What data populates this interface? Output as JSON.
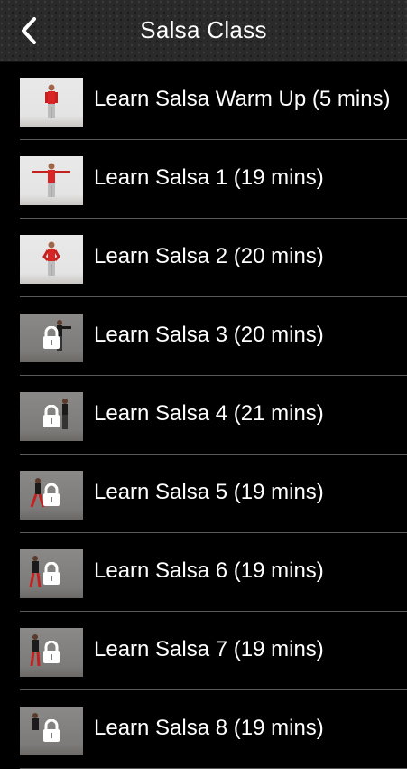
{
  "header": {
    "title": "Salsa Class",
    "back_label": "<"
  },
  "lessons": [
    {
      "title": "Learn Salsa Warm Up (5 mins)",
      "locked": false
    },
    {
      "title": "Learn Salsa 1 (19 mins)",
      "locked": false
    },
    {
      "title": "Learn Salsa 2 (20 mins)",
      "locked": false
    },
    {
      "title": "Learn Salsa 3 (20 mins)",
      "locked": true
    },
    {
      "title": "Learn Salsa 4 (21 mins)",
      "locked": true
    },
    {
      "title": "Learn Salsa 5 (19 mins)",
      "locked": true
    },
    {
      "title": "Learn Salsa 6 (19 mins)",
      "locked": true
    },
    {
      "title": "Learn Salsa 7 (19 mins)",
      "locked": true
    },
    {
      "title": "Learn Salsa 8 (19 mins)",
      "locked": true
    }
  ],
  "icons": {
    "back": "chevron-left-icon",
    "lock": "lock-icon"
  }
}
